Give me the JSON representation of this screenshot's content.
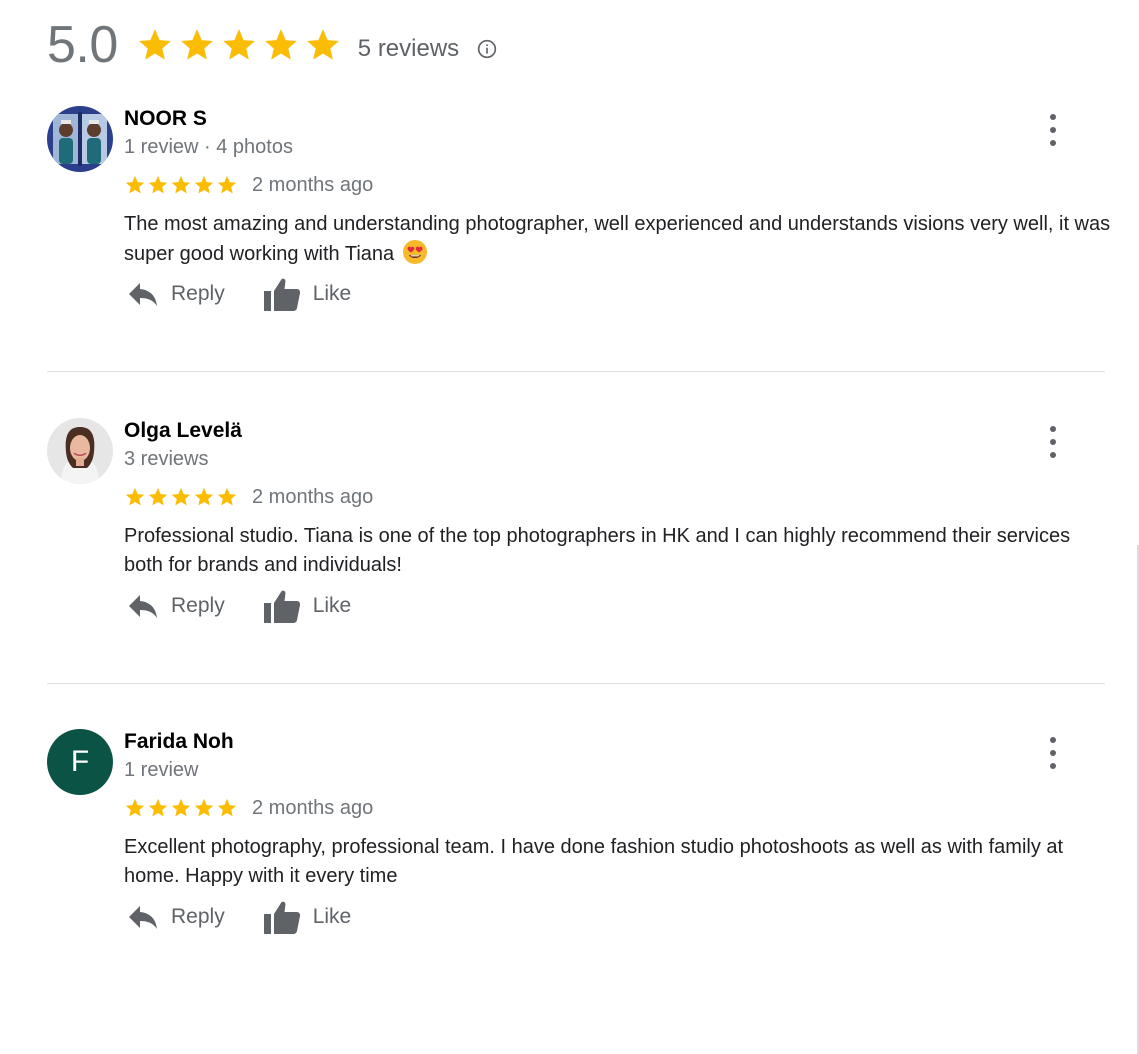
{
  "summary": {
    "average": "5.0",
    "stars": 5,
    "review_count": "5 reviews",
    "info_icon": "info-icon"
  },
  "colors": {
    "star": "#fbbc04",
    "muted_text": "#70757a",
    "action_icon": "#5f6368",
    "avatar_letter_bg": "#0b5345"
  },
  "reviews": [
    {
      "name": "NOOR S",
      "meta": "1 review · 4 photos",
      "rating": 5,
      "time": "2 months ago",
      "text": "The most amazing and understanding photographer, well experienced and understands visions very well, it was super good working with Tiana",
      "emoji": "smiling-face-with-heart-eyes",
      "reply_label": "Reply",
      "like_label": "Like"
    },
    {
      "name": "Olga Levelä",
      "meta": "3 reviews",
      "rating": 5,
      "time": "2 months ago",
      "text": "Professional studio. Tiana is one of the top photographers in HK and I can highly recommend their services both for brands and individuals!",
      "reply_label": "Reply",
      "like_label": "Like"
    },
    {
      "name": "Farida Noh",
      "meta": "1 review",
      "avatar_letter": "F",
      "rating": 5,
      "time": "2 months ago",
      "text": "Excellent photography, professional team. I have done fashion studio photoshoots as well as with family at home. Happy with it every time",
      "reply_label": "Reply",
      "like_label": "Like"
    }
  ]
}
